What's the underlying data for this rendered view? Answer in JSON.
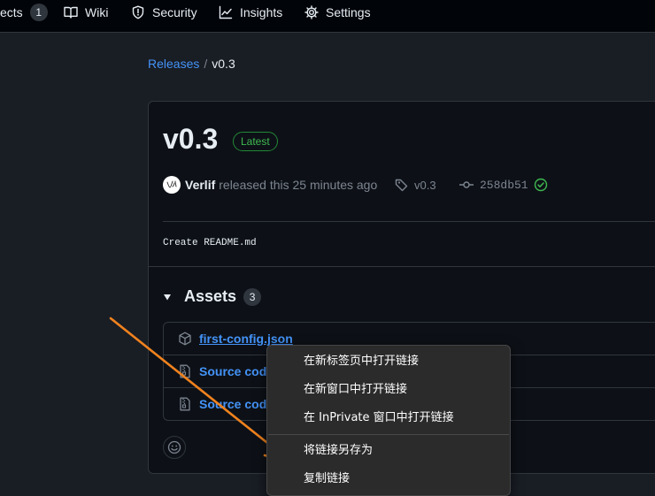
{
  "nav": {
    "tabs": [
      {
        "label": "ects",
        "count": "1"
      },
      {
        "label": "Wiki"
      },
      {
        "label": "Security"
      },
      {
        "label": "Insights"
      },
      {
        "label": "Settings"
      }
    ]
  },
  "breadcrumb": {
    "root": "Releases",
    "separator": "/",
    "current": "v0.3"
  },
  "release": {
    "title": "v0.3",
    "badge": "Latest",
    "author": "Verlif",
    "released_text": "released this 25 minutes ago",
    "tag": "v0.3",
    "commit": "258db51",
    "commit_message": "Create README.md"
  },
  "assets": {
    "title": "Assets",
    "count": "3",
    "items": [
      {
        "name": "first-config.json",
        "icon": "package-icon"
      },
      {
        "name": "Source code",
        "icon": "file-zip-icon"
      },
      {
        "name": "Source code",
        "icon": "file-zip-icon"
      }
    ]
  },
  "context_menu": {
    "items": [
      "在新标签页中打开链接",
      "在新窗口中打开链接",
      "在 InPrivate 窗口中打开链接",
      "将链接另存为",
      "复制链接"
    ]
  },
  "colors": {
    "accent_link": "#4493f8",
    "latest_green": "#3fb950",
    "annotation_arrow": "#f0821e",
    "menu_bg": "#2b2b2b"
  }
}
